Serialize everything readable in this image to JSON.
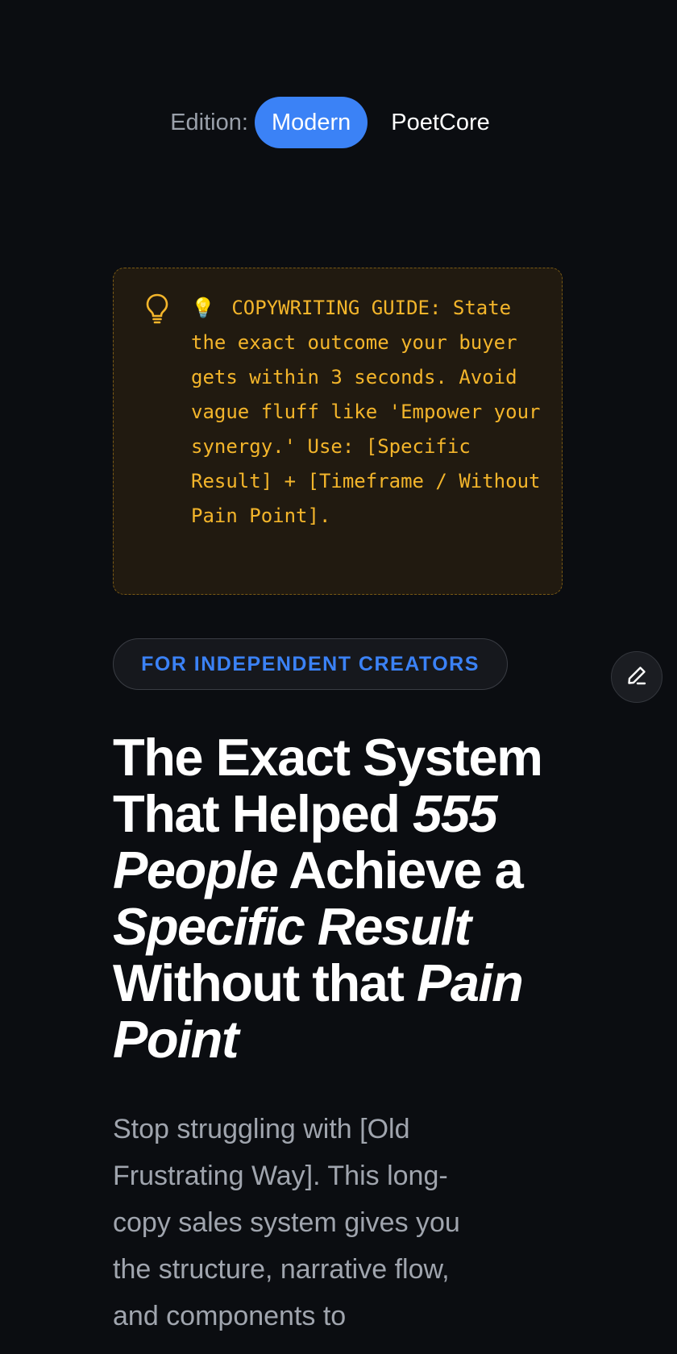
{
  "edition": {
    "label": "Edition:",
    "options": [
      "Modern",
      "PoetCore"
    ],
    "selected": "Modern"
  },
  "guide": {
    "icon": "lightbulb-icon",
    "emoji": "💡",
    "text": "COPYWRITING GUIDE: State the exact outcome your buyer gets within 3 seconds. Avoid vague fluff like 'Empower your synergy.' Use: [Specific Result] + [Timeframe / Without Pain Point]."
  },
  "audience_badge": "FOR INDEPENDENT CREATORS",
  "edit_button_icon": "pencil-icon",
  "headline": {
    "part1": "The Exact System That Helped ",
    "em1": "555 People",
    "part2": " Achieve a ",
    "em2": "Specific Result",
    "part3": " Without that ",
    "em3": "Pain Point"
  },
  "subcopy": "Stop struggling with [Old Frustrating Way]. This long-copy sales system gives you the structure, narrative flow, and components to",
  "colors": {
    "accent": "#3b82f6",
    "guide_text": "#f3b52b",
    "background": "#0b0d11"
  }
}
